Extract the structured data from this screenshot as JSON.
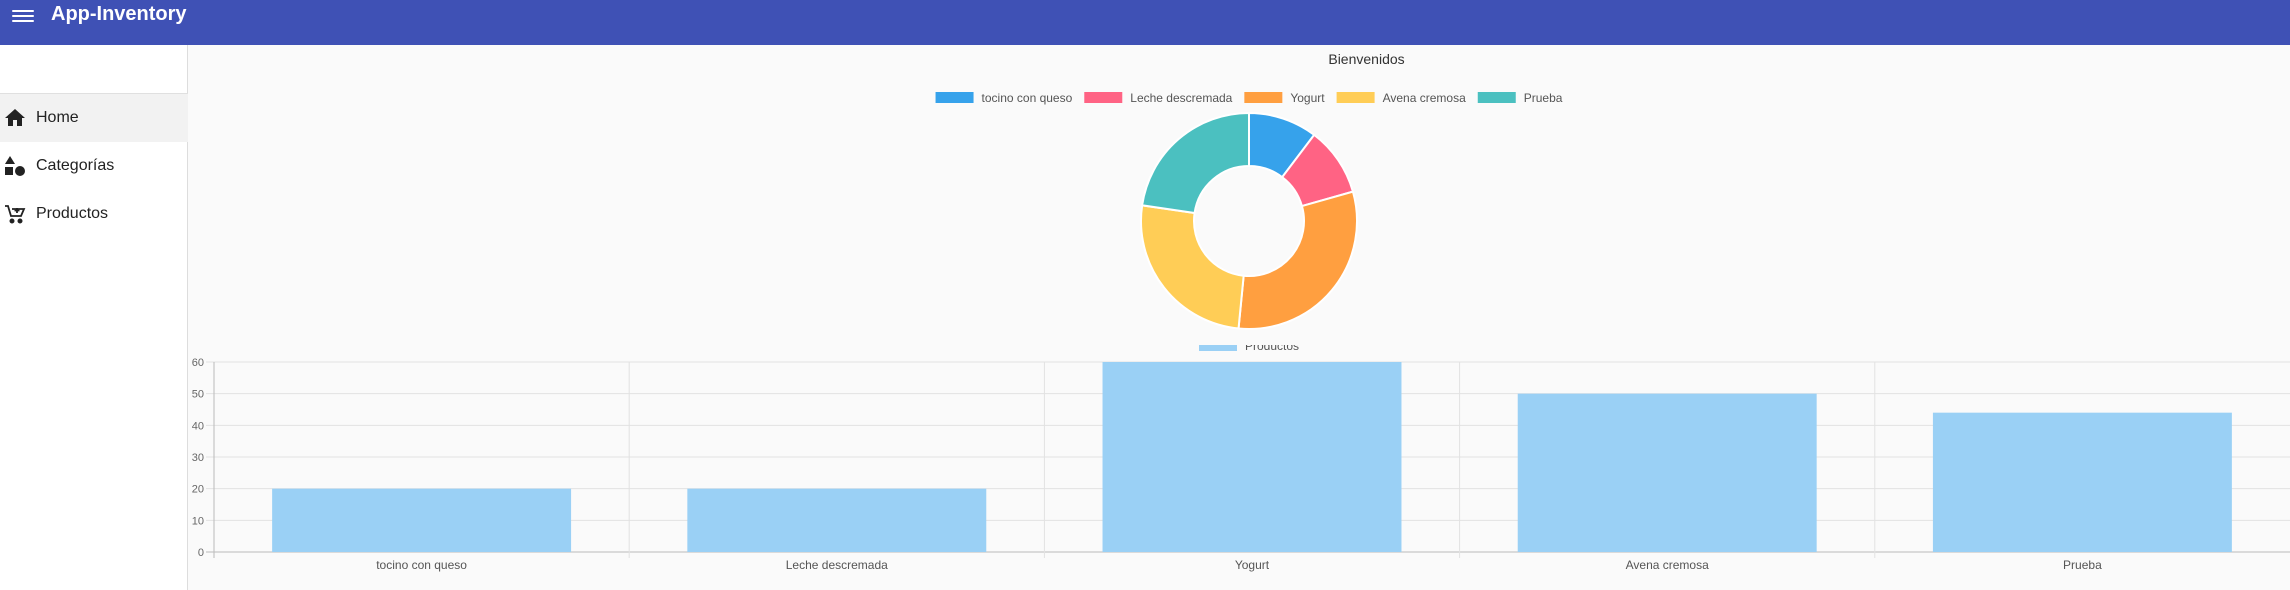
{
  "app": {
    "title": "App-Inventory"
  },
  "sidebar": {
    "items": [
      {
        "label": "Home",
        "icon": "home-icon",
        "active": true
      },
      {
        "label": "Categorías",
        "icon": "category-icon",
        "active": false
      },
      {
        "label": "Productos",
        "icon": "cart-icon",
        "active": false
      }
    ]
  },
  "colors": {
    "toolbar": "#3f51b5"
  },
  "chart_data": [
    {
      "type": "pie",
      "variant": "doughnut",
      "title": "Bienvenidos",
      "categories": [
        "tocino con queso",
        "Leche descremada",
        "Yogurt",
        "Avena cremosa",
        "Prueba"
      ],
      "values": [
        20,
        20,
        60,
        50,
        44
      ],
      "colors": [
        "#36a2eb",
        "#ff6384",
        "#ff9f40",
        "#ffcd56",
        "#4bc0c0"
      ],
      "legend": "top"
    },
    {
      "type": "bar",
      "categories": [
        "tocino con queso",
        "Leche descremada",
        "Yogurt",
        "Avena cremosa",
        "Prueba"
      ],
      "series": [
        {
          "name": "Productos",
          "values": [
            20,
            20,
            60,
            50,
            44
          ],
          "color": "#9ad0f5"
        }
      ],
      "ylim": [
        0,
        60
      ],
      "yticks": [
        0,
        10,
        20,
        30,
        40,
        50,
        60
      ],
      "grid": true,
      "legend": "top"
    }
  ]
}
